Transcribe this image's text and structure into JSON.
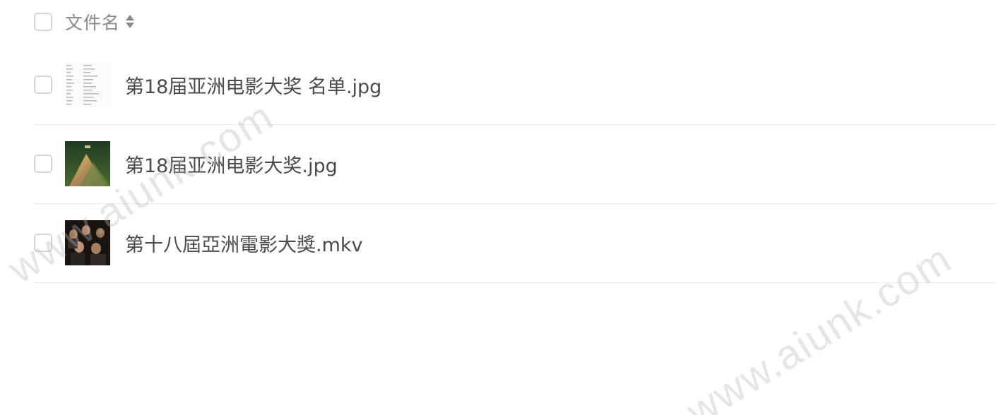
{
  "header": {
    "column_label": "文件名",
    "sort_icon": "sort-icon"
  },
  "files": [
    {
      "name": "第18届亚洲电影大奖 名单.jpg",
      "thumbnail": "document-thumbnail"
    },
    {
      "name": "第18届亚洲电影大奖.jpg",
      "thumbnail": "poster-thumbnail"
    },
    {
      "name": "第十八屆亞洲電影大獎.mkv",
      "thumbnail": "video-thumbnail"
    }
  ],
  "watermark": {
    "text": "www.aiunk.com"
  }
}
